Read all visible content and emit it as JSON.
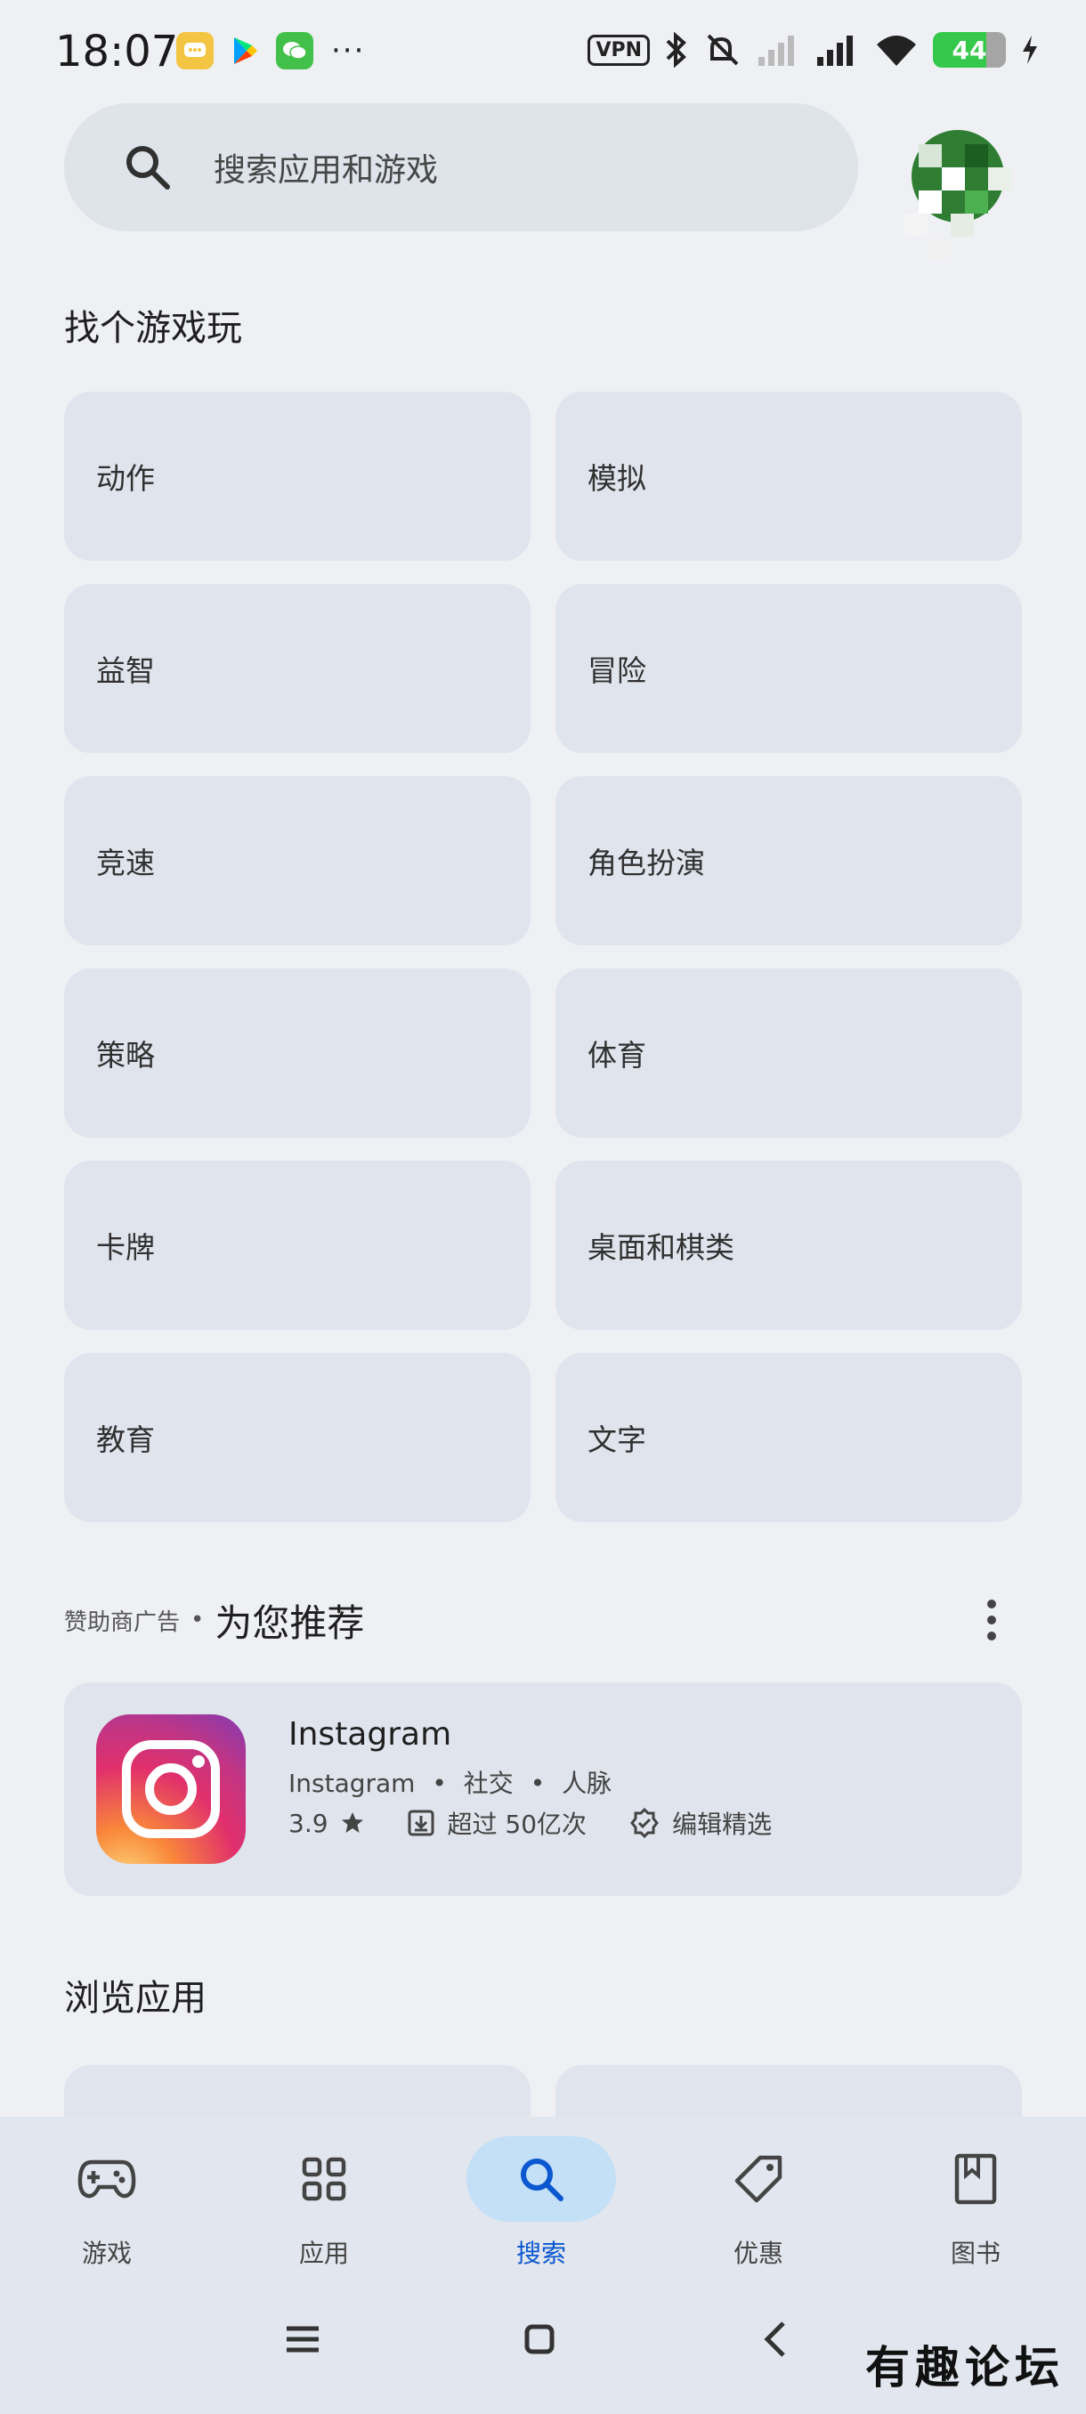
{
  "status_bar": {
    "time": "18:07",
    "vpn_label": "VPN",
    "battery_level": "44",
    "icons": [
      "message-icon",
      "play-store-icon",
      "wechat-icon",
      "more-dots",
      "bluetooth-icon",
      "mute-icon",
      "signal-icon",
      "signal-icon",
      "wifi-icon",
      "charging-icon"
    ],
    "more_label": "···"
  },
  "search": {
    "placeholder": "搜索应用和游戏"
  },
  "games_section": {
    "title": "找个游戏玩",
    "categories": [
      "动作",
      "模拟",
      "益智",
      "冒险",
      "竞速",
      "角色扮演",
      "策略",
      "体育",
      "卡牌",
      "桌面和棋类",
      "教育",
      "文字"
    ]
  },
  "recommend": {
    "ad_label": "赞助商广告",
    "separator": "•",
    "title": "为您推荐",
    "app": {
      "name": "Instagram",
      "developer": "Instagram",
      "tag1": "社交",
      "tag2": "人脉",
      "rating": "3.9",
      "downloads": "超过 50亿次",
      "badge": "编辑精选"
    }
  },
  "browse": {
    "title": "浏览应用"
  },
  "bottom_nav": {
    "items": [
      {
        "label": "游戏",
        "icon": "gamepad-icon"
      },
      {
        "label": "应用",
        "icon": "apps-grid-icon"
      },
      {
        "label": "搜索",
        "icon": "search-icon"
      },
      {
        "label": "优惠",
        "icon": "tag-icon"
      },
      {
        "label": "图书",
        "icon": "book-icon"
      }
    ],
    "active_index": 2
  },
  "watermark": "有趣论坛",
  "colors": {
    "background": "#eef0f4",
    "tile": "#e0e4ec",
    "active_pill": "#c3e0f7",
    "active_text": "#0b57d0"
  }
}
